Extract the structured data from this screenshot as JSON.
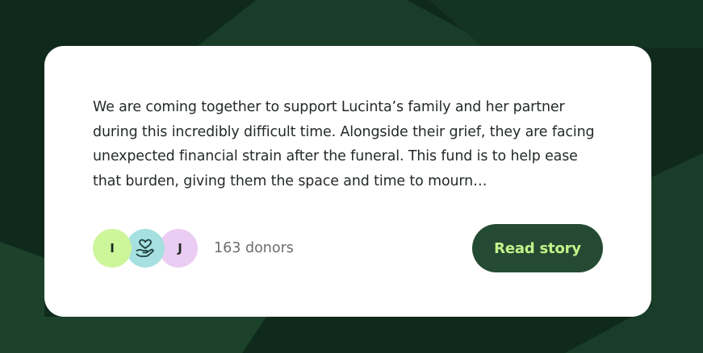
{
  "story": {
    "text": "We are coming together to support Lucinta’s family and her partner during this incredibly difficult time. Alongside their grief, they are facing unexpected financial strain after the funeral. This fund is to help ease that burden, giving them the space and time to mourn…"
  },
  "donors": {
    "avatars": [
      {
        "initial": "I",
        "color": "#cdf59a"
      },
      {
        "icon": "heart-hand-icon",
        "color": "#a6e0e1"
      },
      {
        "initial": "J",
        "color": "#ebcdf3"
      }
    ],
    "count_label": "163 donors"
  },
  "actions": {
    "read_story_label": "Read story"
  },
  "colors": {
    "background": "#0f2a1c",
    "card": "#ffffff",
    "button_bg": "#254a33",
    "button_text": "#c5f28b"
  }
}
